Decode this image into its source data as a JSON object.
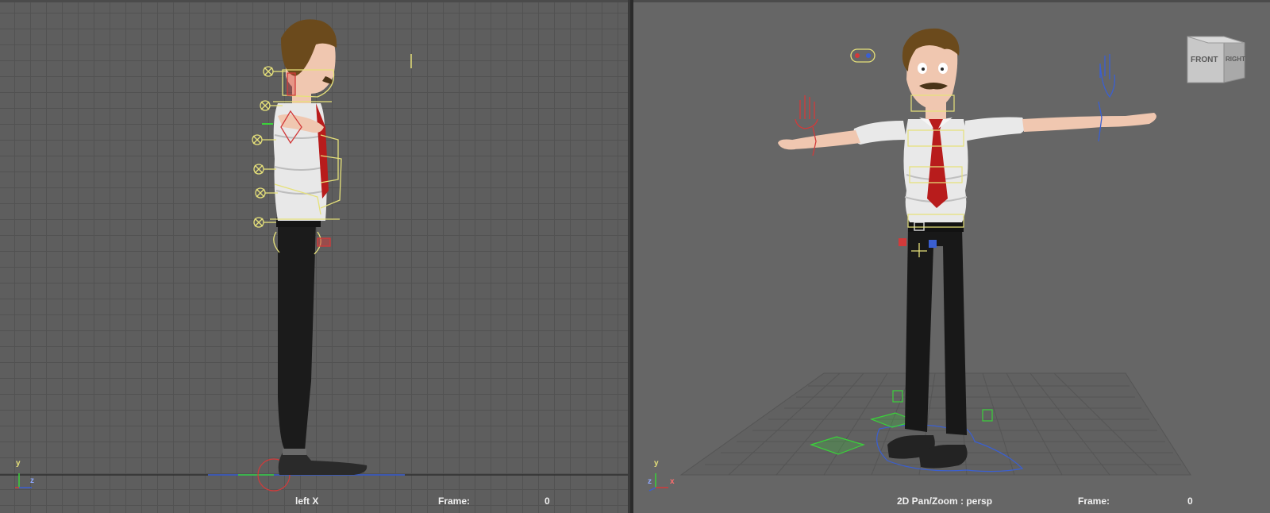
{
  "left_viewport": {
    "camera_label": "left X",
    "frame_label": "Frame:",
    "frame_value": "0",
    "axis_labels": {
      "y": "y",
      "z": "z"
    }
  },
  "right_viewport": {
    "camera_label": "2D Pan/Zoom : persp",
    "frame_label": "Frame:",
    "frame_value": "0",
    "axis_labels": {
      "y": "y",
      "z": "z",
      "x": "x"
    },
    "viewcube": {
      "front": "FRONT",
      "right": "RIGHT"
    }
  },
  "colors": {
    "viewport_bg": "#5d5d5d",
    "grid_line": "#525252",
    "control_yellow": "#e6e17a",
    "control_red": "#d23a3a",
    "control_blue": "#3a5fd2",
    "control_green": "#3ad23a",
    "shirt": "#e8e8e8",
    "tie": "#b81c1c",
    "pants": "#1b1b1b",
    "hair": "#6b4a1c",
    "skin": "#f0c7b0"
  }
}
